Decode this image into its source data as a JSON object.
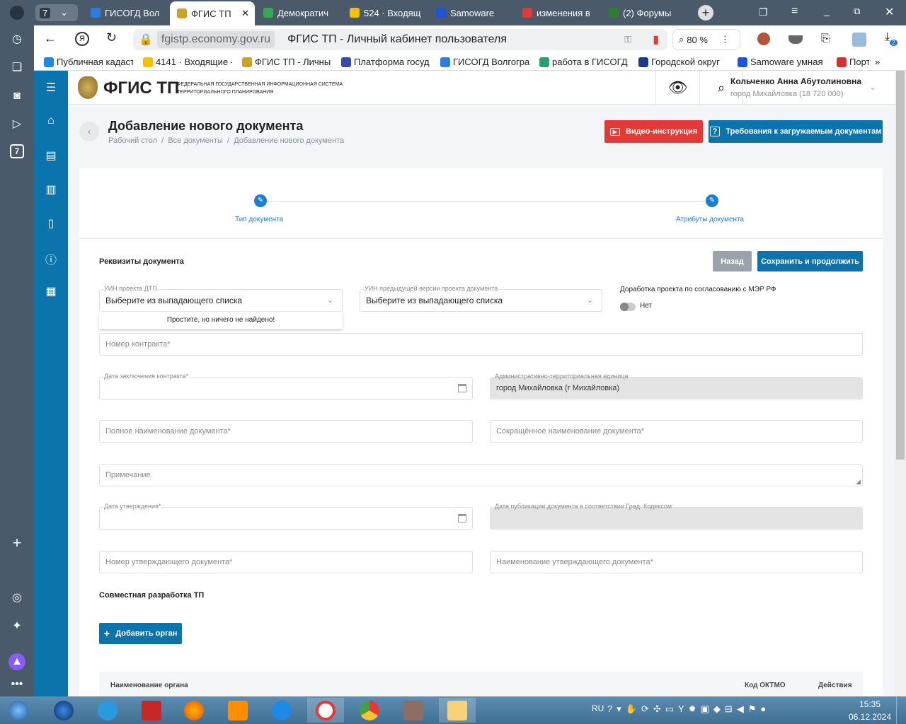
{
  "browser": {
    "tab_count": "7",
    "tabs": [
      {
        "title": "ГИСОГД Вол",
        "color": "#2b7de1"
      },
      {
        "title": "ФГИС ТП",
        "color": "#c9a227",
        "active": true
      },
      {
        "title": "Демократич",
        "color": "#34a853"
      },
      {
        "title": "524 · Входящ",
        "color": "#f5c000"
      },
      {
        "title": "Samoware",
        "color": "#1a56d6"
      },
      {
        "title": "изменения в",
        "color": "#e53935"
      },
      {
        "title": "(2) Форумы",
        "color": "#2e7d32"
      }
    ],
    "url": "fgistp.economy.gov.ru",
    "page_title": "ФГИС ТП - Личный кабинет пользователя",
    "zoom": "80 %",
    "download_badge": "2",
    "bookmarks": [
      {
        "title": "Публичная кадаст",
        "color": "#1e88e5"
      },
      {
        "title": "4141 · Входящие -",
        "color": "#f5c000"
      },
      {
        "title": "ФГИС ТП - Личны",
        "color": "#c9a227"
      },
      {
        "title": "Платформа госуд",
        "color": "#3949ab"
      },
      {
        "title": "ГИСОГД Волгогра",
        "color": "#2b7de1"
      },
      {
        "title": "работа в ГИСОГД",
        "color": "#2e9e6a"
      },
      {
        "title": "Городской округ",
        "color": "#1a3a8a"
      },
      {
        "title": "Samoware умная",
        "color": "#1a56d6"
      },
      {
        "title": "Порт",
        "color": "#d32f2f"
      }
    ],
    "bookmarks_more": "»"
  },
  "app": {
    "logo_text": "ФГИС ТП",
    "logo_sub1": "ФЕДЕРАЛЬНАЯ ГОСУДАРСТВЕННАЯ ИНФОРМАЦИОННАЯ СИСТЕМА",
    "logo_sub2": "ТЕРРИТОРИАЛЬНОГО ПЛАНИРОВАНИЯ",
    "user_name": "Кольченко Анна Абутолиновна",
    "user_org": "город Михайловка (18 720 000)",
    "sidebar_icons": [
      "menu-icon",
      "home-icon",
      "document-list-icon",
      "map-icon",
      "document-icon",
      "info-icon",
      "grid-icon"
    ]
  },
  "page": {
    "title": "Добавление нового документа",
    "breadcrumb": [
      "Рабочий стол",
      "Все документы",
      "Добавление нового документа"
    ],
    "video_button": "Видео-инструкция",
    "requirements_button": "Требования к загружаемым документам",
    "steps": [
      "Тип документа",
      "Атрибуты документа"
    ],
    "section_title": "Реквизиты документа",
    "back_button": "Назад",
    "save_button": "Сохранить и продолжить",
    "uin_label": "УИН проекта ДТП",
    "uin_value": "Выберите из выпадающего списка",
    "uin_dropdown_message": "Простите, но ничего не найдено!",
    "prev_uin_label": "УИН предыдущей версии проекта документа",
    "prev_uin_value": "Выберите из выпадающего списка",
    "rework_label": "Доработка проекта по согласованию с МЭР РФ",
    "rework_value": "Нет",
    "contract_number": "Номер контракта*",
    "contract_date": "Дата заключения контракта*",
    "atu_label": "Административно-территориальная единица",
    "atu_value": "город Михайловка (г Михайловка)",
    "full_name": "Полное наименование документа*",
    "short_name": "Сокращённое наименование документа*",
    "note": "Примечание",
    "approval_date": "Дата утверждения*",
    "publication_date": "Дата публикации документа в соответствии Град. Кодексом",
    "approving_doc_number": "Номер утверждающего документа*",
    "approving_doc_name": "Наименование утверждающего документа*",
    "joint_title": "Совместная разработка ТП",
    "add_org_button": "Добавить орган",
    "table_headers": [
      "Наименование органа",
      "Код ОКТМО",
      "Действия"
    ]
  },
  "colors": {
    "primary": "#0b74ad",
    "danger": "#e53935",
    "gray_button": "#9aa3ab"
  },
  "taskbar": {
    "lang": "RU",
    "time": "15:35",
    "date": "06.12.2024"
  }
}
